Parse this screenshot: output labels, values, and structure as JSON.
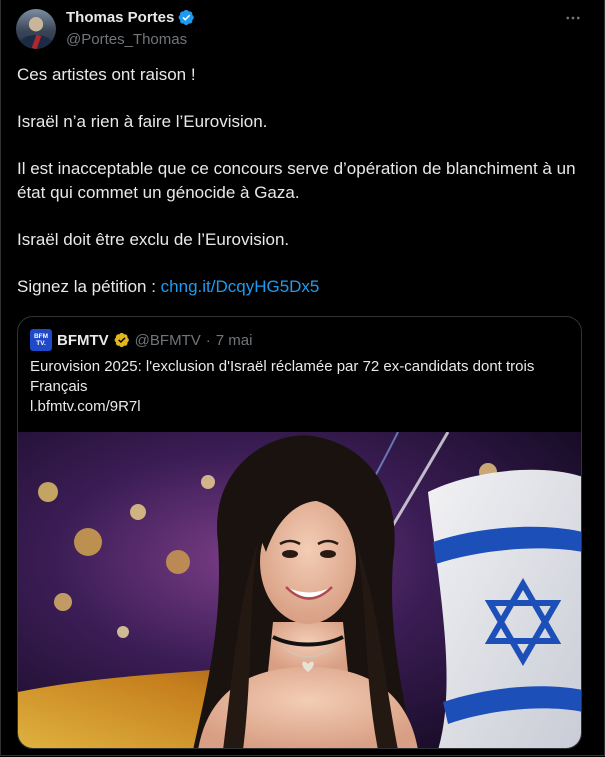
{
  "author": {
    "name": "Thomas Portes",
    "handle": "@Portes_Thomas"
  },
  "tweet": {
    "lines": [
      "Ces artistes ont raison !",
      "Israël n’a rien à faire l’Eurovision.",
      "Il est inacceptable que ce concours serve d’opération de blanchiment à un état qui commet un génocide à Gaza.",
      "Israël doit être exclu de l’Eurovision."
    ],
    "petition_label": "Signez la pétition : ",
    "petition_link": "chng.it/DcqyHG5Dx5"
  },
  "quote": {
    "logo_text": "BFM TV.",
    "name": "BFMTV",
    "handle": "@BFMTV",
    "separator": "·",
    "date": "7 mai",
    "text": "Eurovision 2025: l'exclusion d'Israël réclamée par 72 ex-candidats dont trois Français",
    "link": "l.bfmtv.com/9R7l"
  },
  "colors": {
    "background": "#000000",
    "text": "#e7e9ea",
    "secondary": "#71767b",
    "link": "#1d9bf0",
    "verified_blue": "#1d9bf0",
    "verified_gold": "#e2b719",
    "border": "#2f3336"
  },
  "icons": {
    "more": "more-horizontal-icon",
    "verified": "verified-badge-icon"
  }
}
